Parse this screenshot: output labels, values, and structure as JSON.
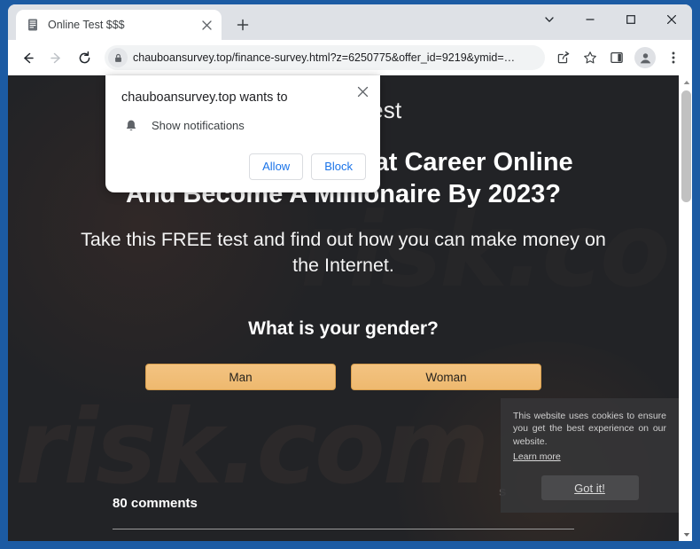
{
  "window": {
    "controls": {
      "tab_search": "tab-search",
      "minimize": "minimize",
      "maximize": "maximize",
      "close": "close"
    }
  },
  "tabstrip": {
    "tabs": [
      {
        "title": "Online Test $$$",
        "favicon": "document-icon",
        "close_label": "×"
      }
    ],
    "new_tab_label": "+"
  },
  "toolbar": {
    "back_label": "Back",
    "forward_label": "Forward",
    "reload_label": "Reload",
    "url": "chauboansurvey.top/finance-survey.html?z=6250775&offer_id=9219&ymid=…",
    "lock_icon": "lock-icon",
    "share_icon": "share-icon",
    "bookmark_icon": "star-icon",
    "side_panel_icon": "side-panel-icon",
    "profile_icon": "profile-avatar-icon",
    "menu_icon": "three-dot-menu-icon"
  },
  "permission_bubble": {
    "title": "chauboansurvey.top wants to",
    "permission_icon": "bell-icon",
    "permission_label": "Show notifications",
    "allow_label": "Allow",
    "block_label": "Block",
    "close_label": "✕"
  },
  "page": {
    "site_title": "Online Test",
    "headline_line1": "Want To Create A Great Career Online",
    "headline_line2": "And Become A Millionaire By 2023?",
    "subhead": "Take this FREE test and find out how you can make money on the Internet.",
    "question": "What is your gender?",
    "answers": [
      {
        "label": "Man"
      },
      {
        "label": "Woman"
      }
    ],
    "comments_count": "80 comments",
    "ghost_char": "s",
    "watermark": "risk.com",
    "watermark_top": "risk.co"
  },
  "cookie_notice": {
    "text": "This website uses cookies to ensure you get the best experience on our website.",
    "learn_more": "Learn more",
    "accept_label": "Got it!"
  },
  "colors": {
    "window_frame": "#1c5ba3",
    "page_bg": "#222326",
    "answer_button": "#f0bd75",
    "link_blue": "#1a73e8"
  }
}
